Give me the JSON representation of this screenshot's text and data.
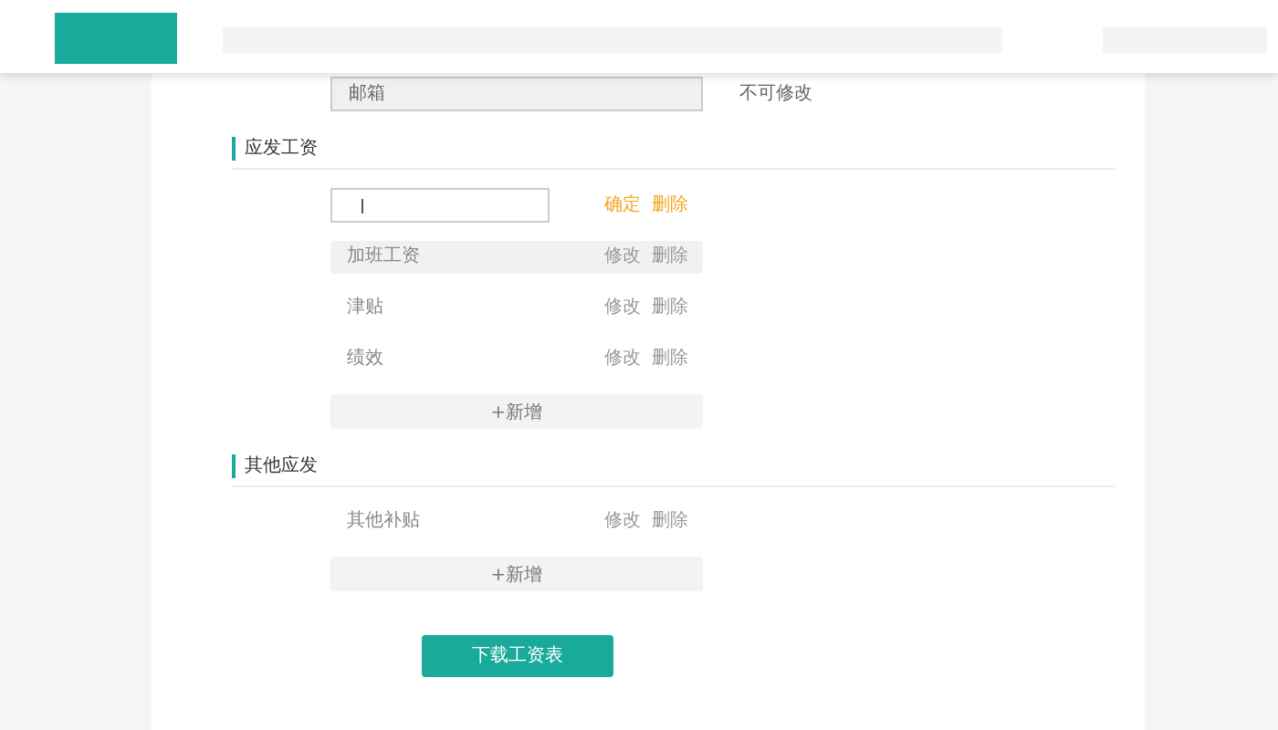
{
  "top_row": {
    "field_value": "邮箱",
    "note": "不可修改"
  },
  "sections": [
    {
      "title": "应发工资",
      "items": [
        {
          "kind": "input",
          "actions": [
            "确定",
            "删除"
          ]
        },
        {
          "kind": "row",
          "label": "加班工资",
          "highlighted": true,
          "actions": [
            "修改",
            "删除"
          ]
        },
        {
          "kind": "row",
          "label": "津贴",
          "highlighted": false,
          "actions": [
            "修改",
            "删除"
          ]
        },
        {
          "kind": "row",
          "label": "绩效",
          "highlighted": false,
          "actions": [
            "修改",
            "删除"
          ]
        }
      ],
      "add_label": "+新增"
    },
    {
      "title": "其他应发",
      "items": [
        {
          "kind": "row",
          "label": "其他补贴",
          "highlighted": false,
          "actions": [
            "修改",
            "删除"
          ]
        }
      ],
      "add_label": "+新增"
    }
  ],
  "download_button": "下载工资表"
}
